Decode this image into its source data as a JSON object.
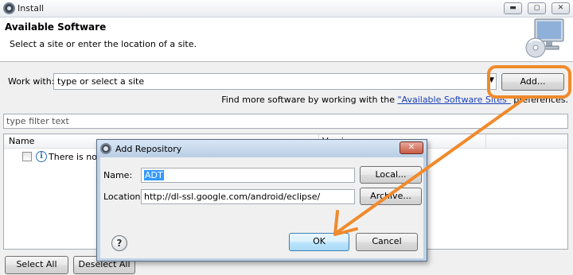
{
  "window": {
    "title": "Install",
    "controls": {
      "minimize": "▬",
      "maximize": "◻",
      "close": "✕"
    }
  },
  "header": {
    "title": "Available Software",
    "subtitle": "Select a site or enter the location of a site."
  },
  "work_with": {
    "label": "Work with:",
    "value": "type or select a site",
    "add_label": "Add..."
  },
  "find_more": {
    "prefix": "Find more software by working with the ",
    "link": "\"Available Software Sites\"",
    "suffix": " preferences."
  },
  "filter": {
    "placeholder": "type filter text"
  },
  "tree": {
    "columns": [
      "Name",
      "Version"
    ],
    "rows": [
      {
        "text": "There is no site selected."
      }
    ]
  },
  "footer": {
    "select_all": "Select All",
    "deselect_all": "Deselect All"
  },
  "dialog": {
    "title": "Add Repository",
    "close": "✕",
    "name_label": "Name:",
    "name_value": "ADT",
    "local_label": "Local...",
    "location_label": "Location:",
    "location_value": "http://dl-ssl.google.com/android/eclipse/",
    "archive_label": "Archive...",
    "help": "?",
    "ok_label": "OK",
    "cancel_label": "Cancel"
  },
  "colors": {
    "annotation": "#f08a2c",
    "selection": "#3399ff",
    "link": "#1a3fb8"
  },
  "icons": [
    "eclipse-icon",
    "install-banner-icon",
    "info-icon",
    "help-icon",
    "dropdown-arrow-icon"
  ]
}
